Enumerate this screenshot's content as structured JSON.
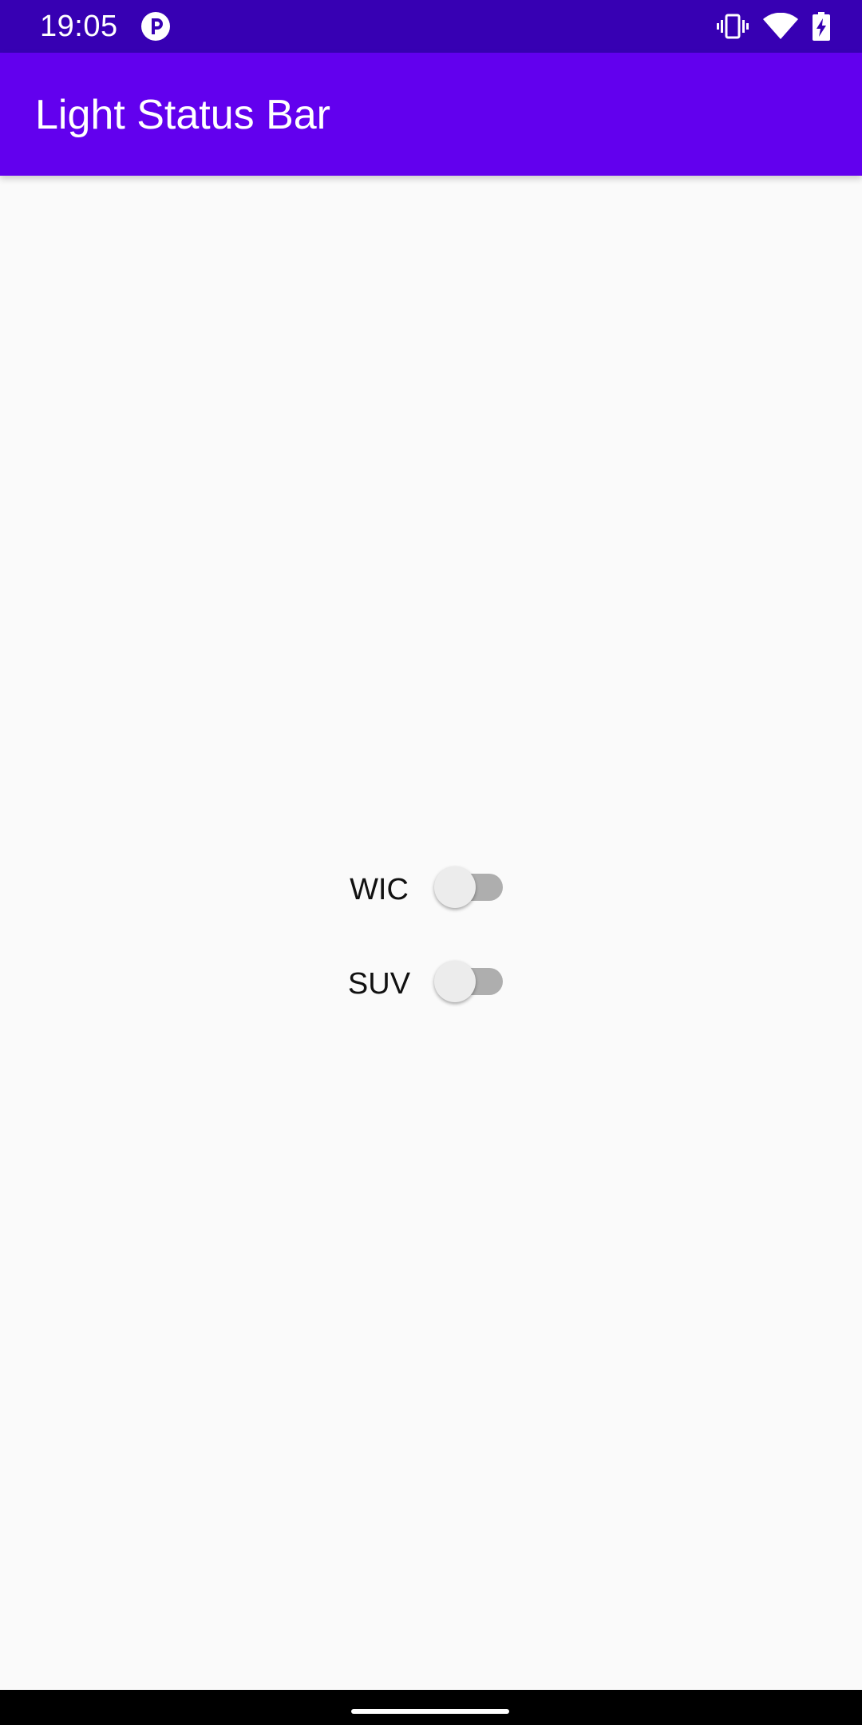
{
  "status_bar": {
    "time": "19:05",
    "app_icon": "notification-app-icon",
    "icons": [
      "vibrate-icon",
      "wifi-icon",
      "battery-charging-icon"
    ],
    "background_color": "#3700b3"
  },
  "app_bar": {
    "title": "Light Status Bar",
    "background_color": "#6200ee"
  },
  "switches": [
    {
      "label": "WIC",
      "checked": false
    },
    {
      "label": "SUV",
      "checked": false
    }
  ],
  "nav_bar": {
    "handle": "gesture-handle"
  }
}
